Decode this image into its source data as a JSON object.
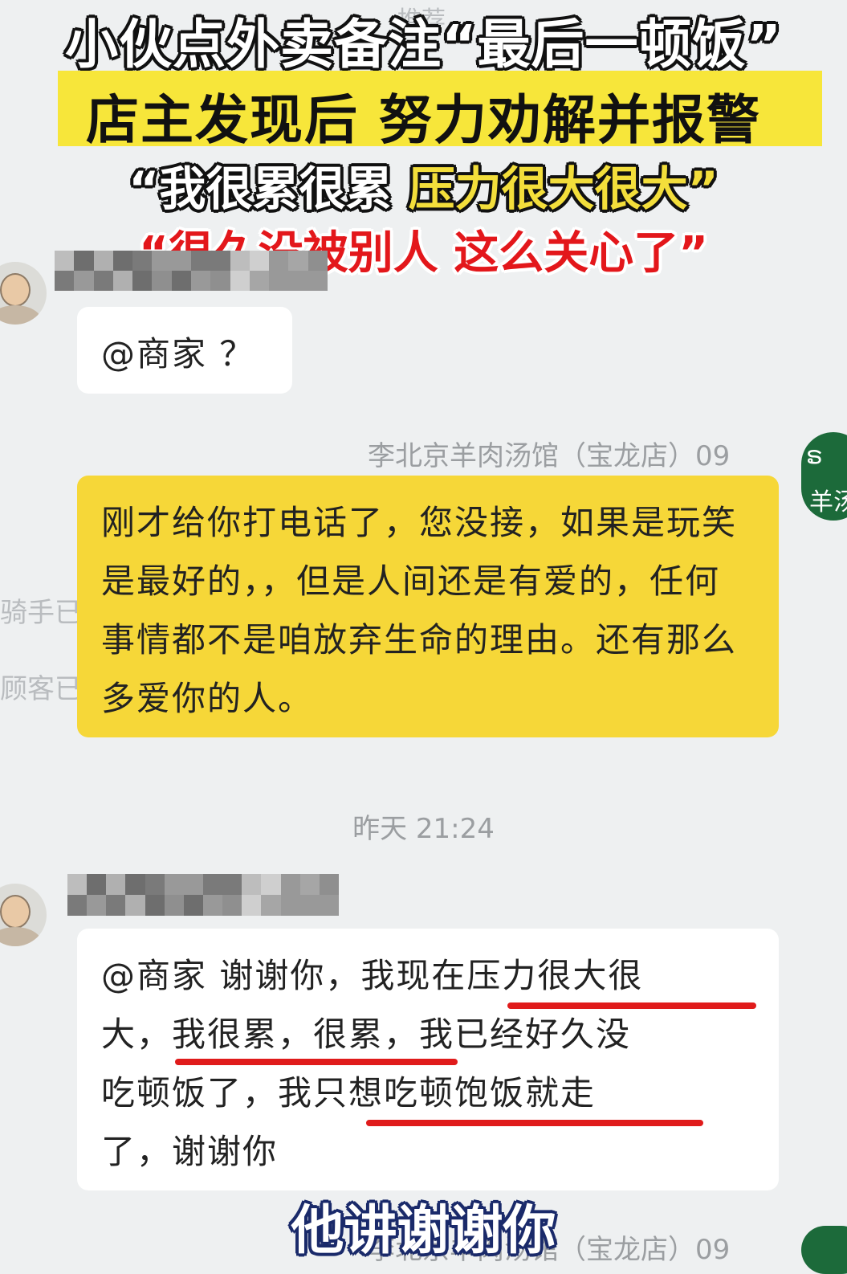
{
  "headlines": {
    "line1": "小伙点外卖备注“最后一顿饭”",
    "line2": "店主发现后 努力劝解并报警",
    "line3_a": "“我很累很累 ",
    "line3_b": "压力很大很大”",
    "line4": "“很久没被别人 这么关心了”"
  },
  "top_nav_ghost": "推荐",
  "left_ghost": [
    "骑手已",
    "顾客已"
  ],
  "messages": [
    {
      "sender": "customer",
      "text": "@商家 ？"
    },
    {
      "sender": "shop",
      "shop_name": "李北京羊肉汤馆（宝龙店）09",
      "text": "刚才给你打电话了，您没接，如果是玩笑是最好的，，但是人间还是有爱的，任何事情都不是咱放弃生命的理由。还有那么多爱你的人。"
    },
    {
      "sender": "customer",
      "text_lines": [
        "@商家 谢谢你，我现在压力很大很",
        "大，我很累，很累，我已经好久没",
        "吃顿饭了，我只想吃顿饱饭就走",
        "了，谢谢你"
      ]
    }
  ],
  "timestamp": "昨天 21:24",
  "shop_logo_text": "羊汤",
  "bottom_shop_name": "李北京羊肉汤馆（宝龙店）09",
  "caption": "他讲谢谢你",
  "colors": {
    "background": "#eef0f1",
    "shop_bubble": "#f6d738",
    "customer_bubble": "#ffffff",
    "underline": "#e01b1b",
    "headline_highlight": "#f7e63a",
    "headline_red": "#e3171b"
  }
}
